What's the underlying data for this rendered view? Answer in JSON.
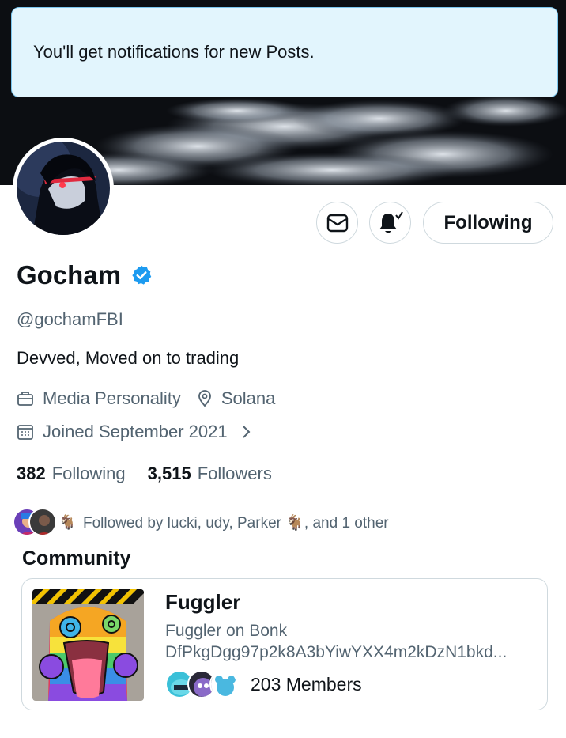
{
  "toast": {
    "message": "You'll get notifications for new Posts."
  },
  "profile": {
    "name": "Gocham",
    "handle": "@gochamFBI",
    "bio": "Devved,  Moved on to trading",
    "category": "Media Personality",
    "location": "Solana",
    "joined": "Joined September 2021"
  },
  "actions": {
    "following_label": "Following"
  },
  "stats": {
    "following_count": "382",
    "following_label": "Following",
    "followers_count": "3,515",
    "followers_label": "Followers"
  },
  "followed_by": {
    "text": "Followed by lucki, udy, Parker 🐐, and 1 other"
  },
  "community": {
    "section_title": "Community",
    "name": "Fuggler",
    "description_line1": "Fuggler on Bonk",
    "description_line2": "DfPkgDgg97p2k8A3bYiwYXX4m2kDzN1bkd...",
    "members": "203 Members"
  },
  "colors": {
    "accent": "#1d9bf0",
    "toast_bg": "#e2f5fd",
    "secondary_text": "#536471",
    "border": "#cfd9de"
  },
  "icons": [
    "mail-icon",
    "bell-check-icon",
    "verified-badge-icon",
    "briefcase-icon",
    "location-pin-icon",
    "calendar-icon",
    "chevron-right-icon"
  ]
}
